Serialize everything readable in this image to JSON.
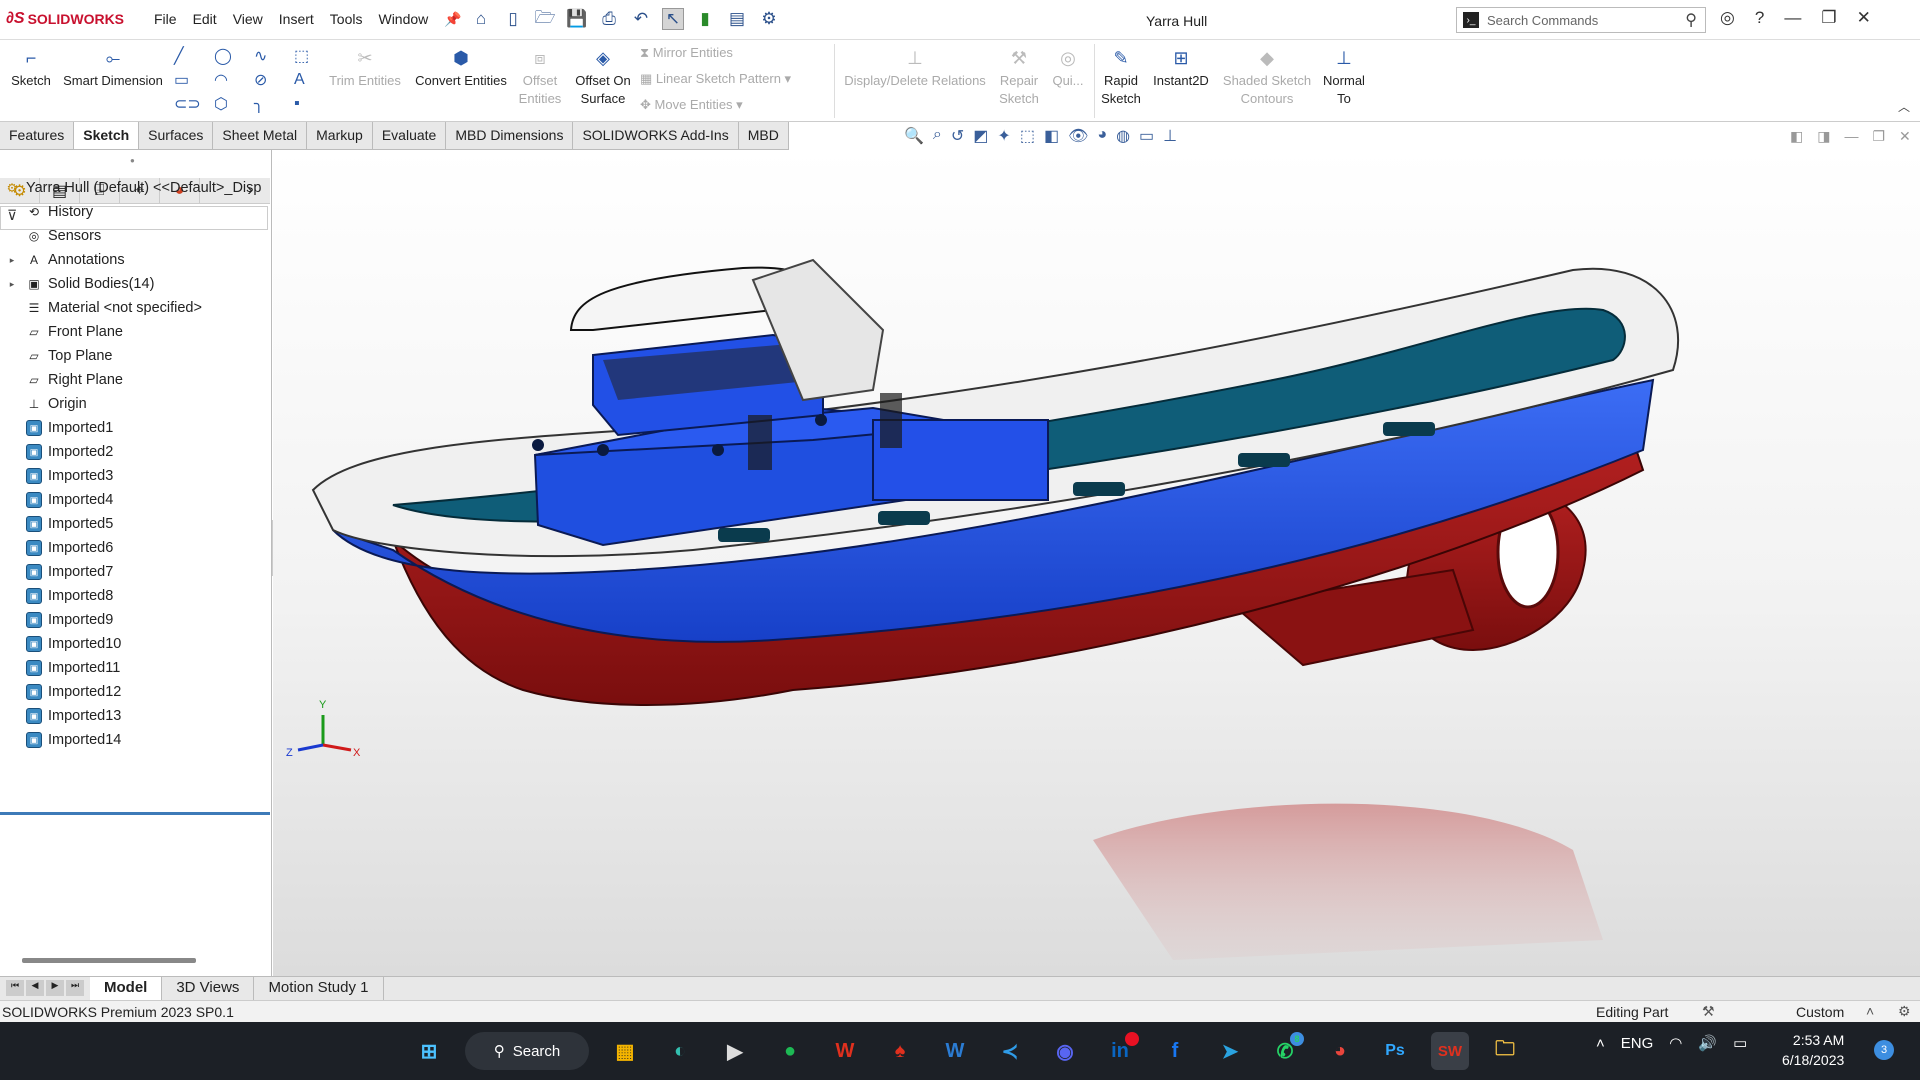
{
  "app": {
    "brand": "SOLIDWORKS",
    "document_title": "Yarra Hull"
  },
  "menu": [
    "File",
    "Edit",
    "View",
    "Insert",
    "Tools",
    "Window"
  ],
  "search": {
    "placeholder": "Search Commands"
  },
  "commands": {
    "sketch": "Sketch",
    "smart_dimension": "Smart Dimension",
    "trim_entities": "Trim Entities",
    "convert_entities": "Convert Entities",
    "offset_entities": "Offset Entities",
    "offset_on_surface": "Offset On Surface",
    "mirror_entities": "Mirror Entities",
    "linear_sketch_pattern": "Linear Sketch Pattern",
    "move_entities": "Move Entities",
    "display_delete_relations": "Display/Delete Relations",
    "repair_sketch": "Repair Sketch",
    "quick_snaps": "Qui...",
    "rapid_sketch": "Rapid Sketch",
    "instant2d": "Instant2D",
    "shaded_sketch_contours": "Shaded Sketch Contours",
    "normal_to": "Normal To"
  },
  "cmd_tabs": [
    "Features",
    "Sketch",
    "Surfaces",
    "Sheet Metal",
    "Markup",
    "Evaluate",
    "MBD Dimensions",
    "SOLIDWORKS Add-Ins",
    "MBD"
  ],
  "active_cmd_tab": "Sketch",
  "feature_tree": {
    "root": "Yarra Hull (Default) <<Default>_Disp",
    "items": [
      {
        "label": "History",
        "icon": "history-icon",
        "expand": false
      },
      {
        "label": "Sensors",
        "icon": "sensors-icon",
        "expand": false
      },
      {
        "label": "Annotations",
        "icon": "annotations-icon",
        "expand": true
      },
      {
        "label": "Solid Bodies(14)",
        "icon": "solid-bodies-icon",
        "expand": true
      },
      {
        "label": "Material <not specified>",
        "icon": "material-icon",
        "expand": false
      },
      {
        "label": "Front Plane",
        "icon": "plane-icon",
        "expand": false
      },
      {
        "label": "Top Plane",
        "icon": "plane-icon",
        "expand": false
      },
      {
        "label": "Right Plane",
        "icon": "plane-icon",
        "expand": false
      },
      {
        "label": "Origin",
        "icon": "origin-icon",
        "expand": false
      },
      {
        "label": "Imported1",
        "icon": "imported-body-icon",
        "expand": false
      },
      {
        "label": "Imported2",
        "icon": "imported-body-icon",
        "expand": false
      },
      {
        "label": "Imported3",
        "icon": "imported-body-icon",
        "expand": false
      },
      {
        "label": "Imported4",
        "icon": "imported-body-icon",
        "expand": false
      },
      {
        "label": "Imported5",
        "icon": "imported-body-icon",
        "expand": false
      },
      {
        "label": "Imported6",
        "icon": "imported-body-icon",
        "expand": false
      },
      {
        "label": "Imported7",
        "icon": "imported-body-icon",
        "expand": false
      },
      {
        "label": "Imported8",
        "icon": "imported-body-icon",
        "expand": false
      },
      {
        "label": "Imported9",
        "icon": "imported-body-icon",
        "expand": false
      },
      {
        "label": "Imported10",
        "icon": "imported-body-icon",
        "expand": false
      },
      {
        "label": "Imported11",
        "icon": "imported-body-icon",
        "expand": false
      },
      {
        "label": "Imported12",
        "icon": "imported-body-icon",
        "expand": false
      },
      {
        "label": "Imported13",
        "icon": "imported-body-icon",
        "expand": false
      },
      {
        "label": "Imported14",
        "icon": "imported-body-icon",
        "expand": false
      }
    ]
  },
  "bottom_tabs": [
    "Model",
    "3D Views",
    "Motion Study 1"
  ],
  "active_bottom_tab": "Model",
  "status": {
    "left": "SOLIDWORKS Premium 2023 SP0.1",
    "mode": "Editing Part",
    "units": "Custom"
  },
  "taskbar": {
    "search_label": "Search",
    "apps": [
      "start-icon",
      "widgets-icon",
      "edge-icon",
      "media-player-icon",
      "spotify-icon",
      "wps-icon",
      "acrobat-icon",
      "word-icon",
      "vscode-icon",
      "discord-icon",
      "linkedin-icon",
      "facebook-icon",
      "telegram-icon",
      "whatsapp-icon",
      "chrome-icon",
      "photoshop-icon",
      "solidworks-icon",
      "file-explorer-icon"
    ],
    "whatsapp_badge": "8",
    "language": "ENG",
    "time": "2:53 AM",
    "date": "6/18/2023",
    "notifications": "3"
  },
  "colors": {
    "hull_blue": "#1f4fe0",
    "bottom_red": "#a01818",
    "deck_teal": "#0f5d78",
    "brand_red": "#c8102e"
  }
}
